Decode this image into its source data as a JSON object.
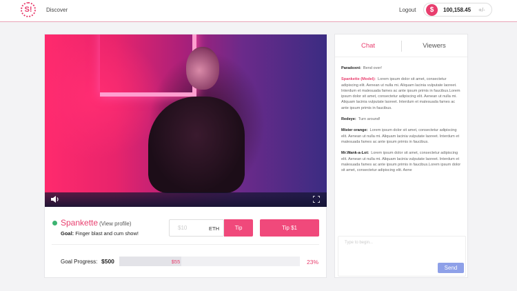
{
  "header": {
    "logo_text": "S!",
    "nav_discover": "Discover",
    "logout": "Logout",
    "coin_text": "$",
    "balance": "100,158.45",
    "add_funds": "+/-"
  },
  "model": {
    "name": "Spankette",
    "view_profile": "(View profile)",
    "goal_label": "Goal:",
    "goal_text": "Finger blast and cum show!",
    "online": true
  },
  "tip": {
    "placeholder": "$10",
    "unit": "ETH",
    "tip_label": "Tip",
    "tip1_label": "Tip $1"
  },
  "goal_progress": {
    "label": "Goal Progress:",
    "goal_amount": "$500",
    "current": "$55",
    "percent_label": "23%",
    "fraction": 0.345
  },
  "chat": {
    "tabs": [
      "Chat",
      "Viewers"
    ],
    "messages": [
      {
        "user": "Paradoxni:",
        "text": "Bend over!",
        "is_model": false
      },
      {
        "user": "Spankette (Model):",
        "text": "Lorem ipsum dolor sit amet, consectetur adipiscing elit. Aenean ut nulla mi. Aliquam lacinia vulputate laoreet. Interdum et malesuada fames ac ante ipsum primis in faucibus.Lorem ipsum dolor sit amet, consectetur adipiscing elit. Aenean ut nulla mi. Aliquam lacinia vulputate laoreet. Interdum et malesuada fames ac ante ipsum primis in faucibus.",
        "is_model": true
      },
      {
        "user": "Redeye:",
        "text": "Turn around!",
        "is_model": false
      },
      {
        "user": "Mister orange:",
        "text": "Lorem ipsum dolor sit amet, consectetur adipiscing elit. Aenean ut nulla mi. Aliquam lacinia vulputate laoreet. Interdum et malesuada fames ac ante ipsum primis in faucibus.",
        "is_model": false
      },
      {
        "user": "Mr.Wank-a-Lot:",
        "text": "Lorem ipsum dolor sit amet, consectetur adipiscing elit. Aenean ut nulla mi. Aliquam lacinia vulputate laoreet. Interdum et malesuada fames ac ante ipsum primis in faucibus.Lorem ipsum dolor sit amet, consectetur adipiscing elit. Aene",
        "is_model": false
      }
    ],
    "input_placeholder": "Type to begin...",
    "send_label": "Send"
  },
  "colors": {
    "accent": "#e83e6e",
    "send": "#8ea0e8",
    "online": "#3cb371"
  }
}
